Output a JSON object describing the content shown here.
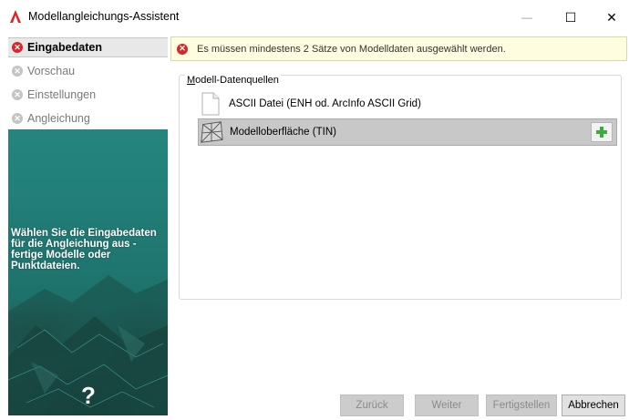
{
  "window": {
    "title": "Modellangleichungs-Assistent",
    "minimize": "—",
    "maximize": "☐",
    "close": "✕",
    "app_icon": "autodesk-a-icon",
    "accent": "#d9262a"
  },
  "steps": [
    {
      "label": "Eingabedaten",
      "state": "error",
      "icon": "error-icon"
    },
    {
      "label": "Vorschau",
      "state": "disabled",
      "icon": "disabled-circle-icon"
    },
    {
      "label": "Einstellungen",
      "state": "disabled",
      "icon": "disabled-circle-icon"
    },
    {
      "label": "Angleichung",
      "state": "disabled",
      "icon": "disabled-circle-icon"
    }
  ],
  "left_panel": {
    "description": "Wählen Sie die Eingabedaten für die Angleichung aus - fertige Modelle oder Punktdateien.",
    "help": "?"
  },
  "message": {
    "icon": "error-icon",
    "text": "Es müssen mindestens 2 Sätze von Modelldaten ausgewählt werden."
  },
  "datasources": {
    "group_label_first": "M",
    "group_label_rest": "odell-Datenquellen",
    "items": [
      {
        "label": "ASCII Datei (ENH od. ArcInfo ASCII Grid)",
        "icon": "document-icon",
        "selected": false
      },
      {
        "label": "Modelloberfläche (TIN)",
        "icon": "tin-surface-icon",
        "selected": true,
        "action_icon": "add-plus-icon"
      }
    ]
  },
  "buttons": {
    "back": "Zurück",
    "next": "Weiter",
    "finish": "Fertigstellen",
    "cancel": "Abbrechen"
  }
}
